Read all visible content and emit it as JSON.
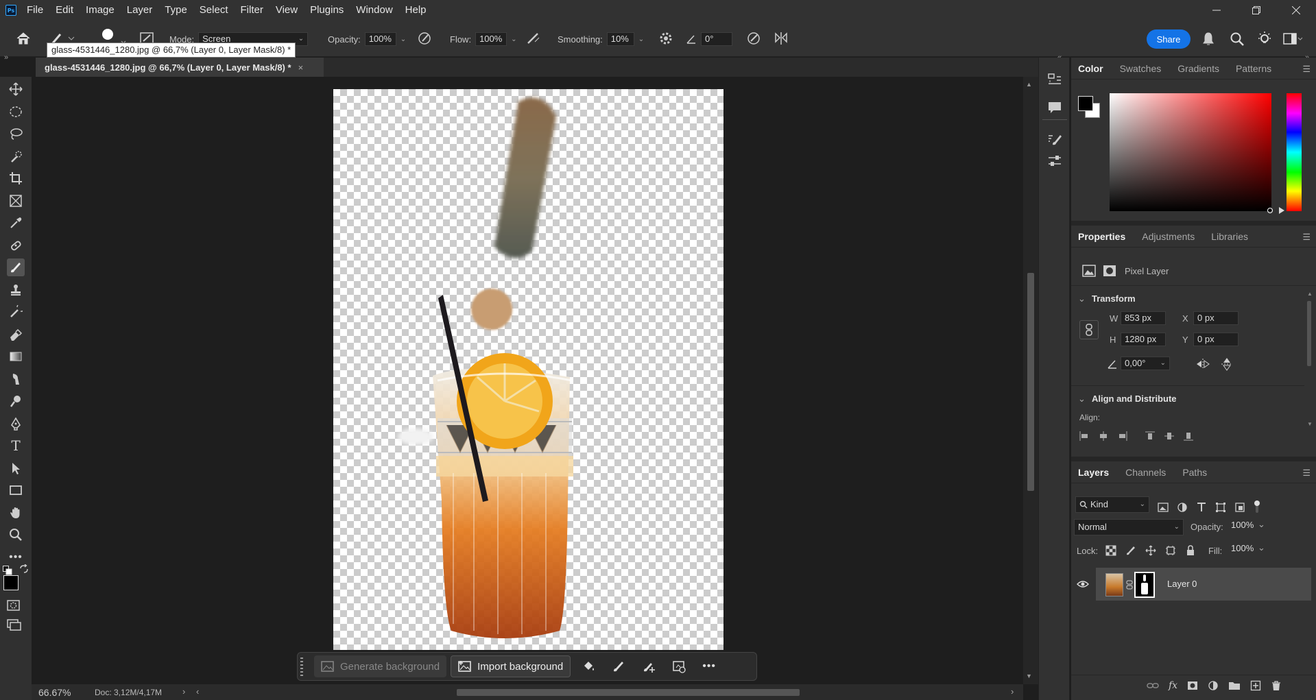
{
  "app": {
    "logo": "Ps"
  },
  "menu": [
    "File",
    "Edit",
    "Image",
    "Layer",
    "Type",
    "Select",
    "Filter",
    "View",
    "Plugins",
    "Window",
    "Help"
  ],
  "options": {
    "mode_label": "Mode:",
    "mode_value": "Screen",
    "opacity_label": "Opacity:",
    "opacity_value": "100%",
    "flow_label": "Flow:",
    "flow_value": "100%",
    "smoothing_label": "Smoothing:",
    "smoothing_value": "10%",
    "angle_value": "0°",
    "share_label": "Share"
  },
  "document": {
    "tab_title": "glass-4531446_1280.jpg @ 66,7% (Layer 0, Layer Mask/8) *",
    "tooltip": "glass-4531446_1280.jpg @ 66,7% (Layer 0, Layer Mask/8) *",
    "close_glyph": "×"
  },
  "contextbar": {
    "generate_label": "Generate background",
    "import_label": "Import background"
  },
  "status": {
    "zoom": "66.67%",
    "doc": "Doc: 3,12M/4,17M"
  },
  "color_panel": {
    "tabs": [
      "Color",
      "Swatches",
      "Gradients",
      "Patterns"
    ],
    "hue_color": "#ff0000"
  },
  "properties": {
    "tabs": [
      "Properties",
      "Adjustments",
      "Libraries"
    ],
    "kind": "Pixel Layer",
    "transform_title": "Transform",
    "w_label": "W",
    "w_value": "853 px",
    "h_label": "H",
    "h_value": "1280 px",
    "x_label": "X",
    "x_value": "0 px",
    "y_label": "Y",
    "y_value": "0 px",
    "angle_value": "0,00°",
    "align_title": "Align and Distribute",
    "align_label": "Align:"
  },
  "layers": {
    "tabs": [
      "Layers",
      "Channels",
      "Paths"
    ],
    "filter_kind": "Kind",
    "blend_mode": "Normal",
    "opacity_label": "Opacity:",
    "opacity_value": "100%",
    "lock_label": "Lock:",
    "fill_label": "Fill:",
    "fill_value": "100%",
    "items": [
      {
        "name": "Layer 0"
      }
    ]
  }
}
